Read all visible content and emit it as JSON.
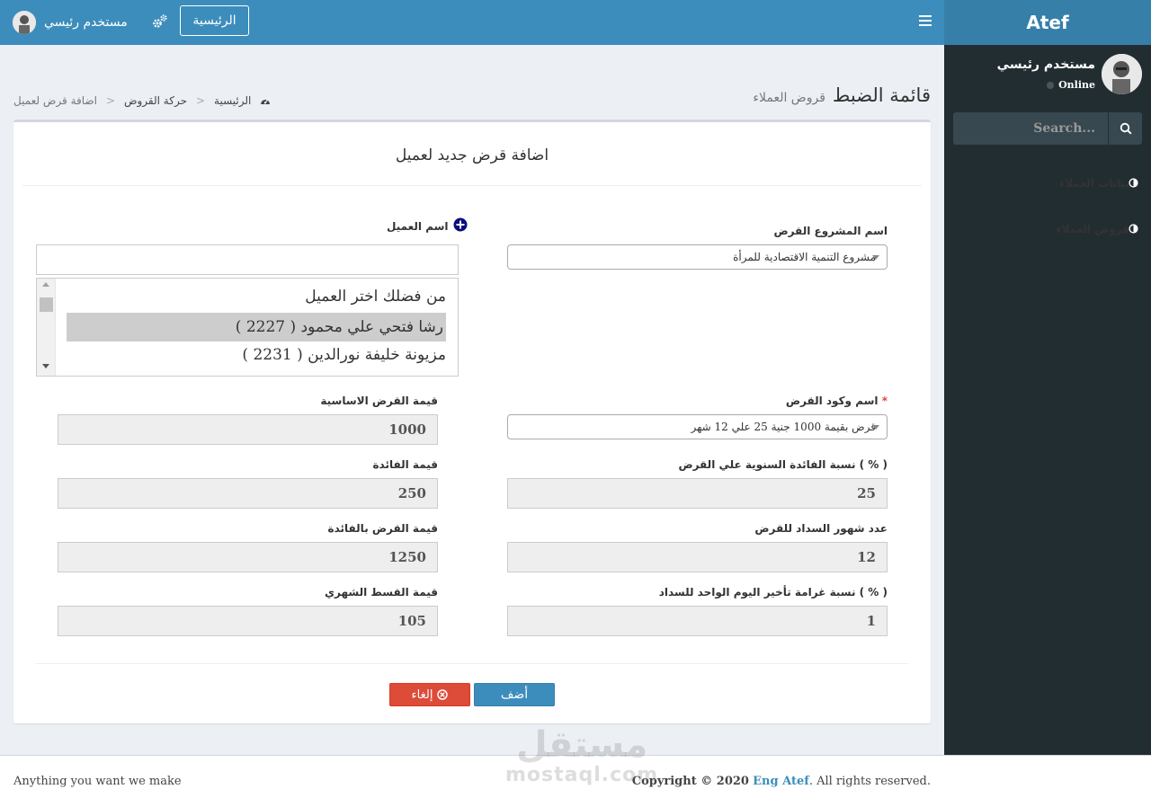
{
  "sidebar": {
    "logo": "Atef",
    "user_name": "مستخدم رئيسي",
    "user_status": "Online",
    "search_placeholder": "Search...",
    "menu": [
      {
        "label": "بيانات العملاء",
        "icon": "circle-half-icon"
      },
      {
        "label": "قروض العملاء",
        "icon": "circle-half-icon"
      }
    ]
  },
  "navbar": {
    "home_label": "الرئيسية",
    "user_name": "مستخدم رئيسي"
  },
  "header": {
    "title": "قائمة الضبط",
    "subtitle": "قروض العملاء",
    "breadcrumb": [
      "الرئيسية",
      "حركة القروض",
      "اضافة قرض لعميل"
    ]
  },
  "form": {
    "title": "اضافة قرض جديد لعميل",
    "project_label": "اسم المشروع القرض",
    "project_value": "مشروع التنمية الاقتصادية للمرأة",
    "client_label": "اسم العميل",
    "client_search_value": "",
    "client_options": [
      "من فضلك اختر العميل",
      "رشا فتحي علي محمود ( 2227 )",
      "مزيونة خليفة نورالدين ( 2231 )"
    ],
    "loan_code_label": "اسم وكود القرض",
    "loan_code_required": "*",
    "loan_code_value": "قرض بقيمة 1000 جنية 25 علي 12 شهر",
    "base_value_label": "قيمة القرض الاساسية",
    "base_value": "1000",
    "interest_rate_label": "نسبة الفائدة السنوية علي القرض ( % )",
    "interest_rate": "25",
    "interest_value_label": "قيمة الفائدة",
    "interest_value": "250",
    "months_label": "عدد شهور السداد للقرض",
    "months": "12",
    "total_label": "قيمة القرض بالفائدة",
    "total": "1250",
    "penalty_label": "نسبة غرامة تأخير اليوم الواحد للسداد ( % )",
    "penalty": "1",
    "installment_label": "قيمة القسط الشهري",
    "installment": "105",
    "add_label": "أضف",
    "cancel_label": "إلغاء"
  },
  "footer": {
    "left": "Anything you want we make",
    "copyright_prefix": "Copyright © 2020",
    "copyright_link": "Eng Atef",
    "copyright_suffix": ". All rights reserved."
  },
  "watermark": {
    "arabic": "مستقل",
    "latin": "mostaql.com"
  },
  "colors": {
    "navbar": "#3c8dbc",
    "logo_bg": "#367fa9",
    "sidebar": "#222d32",
    "primary_button": "#3c8dbc",
    "danger_button": "#dd4b39"
  }
}
